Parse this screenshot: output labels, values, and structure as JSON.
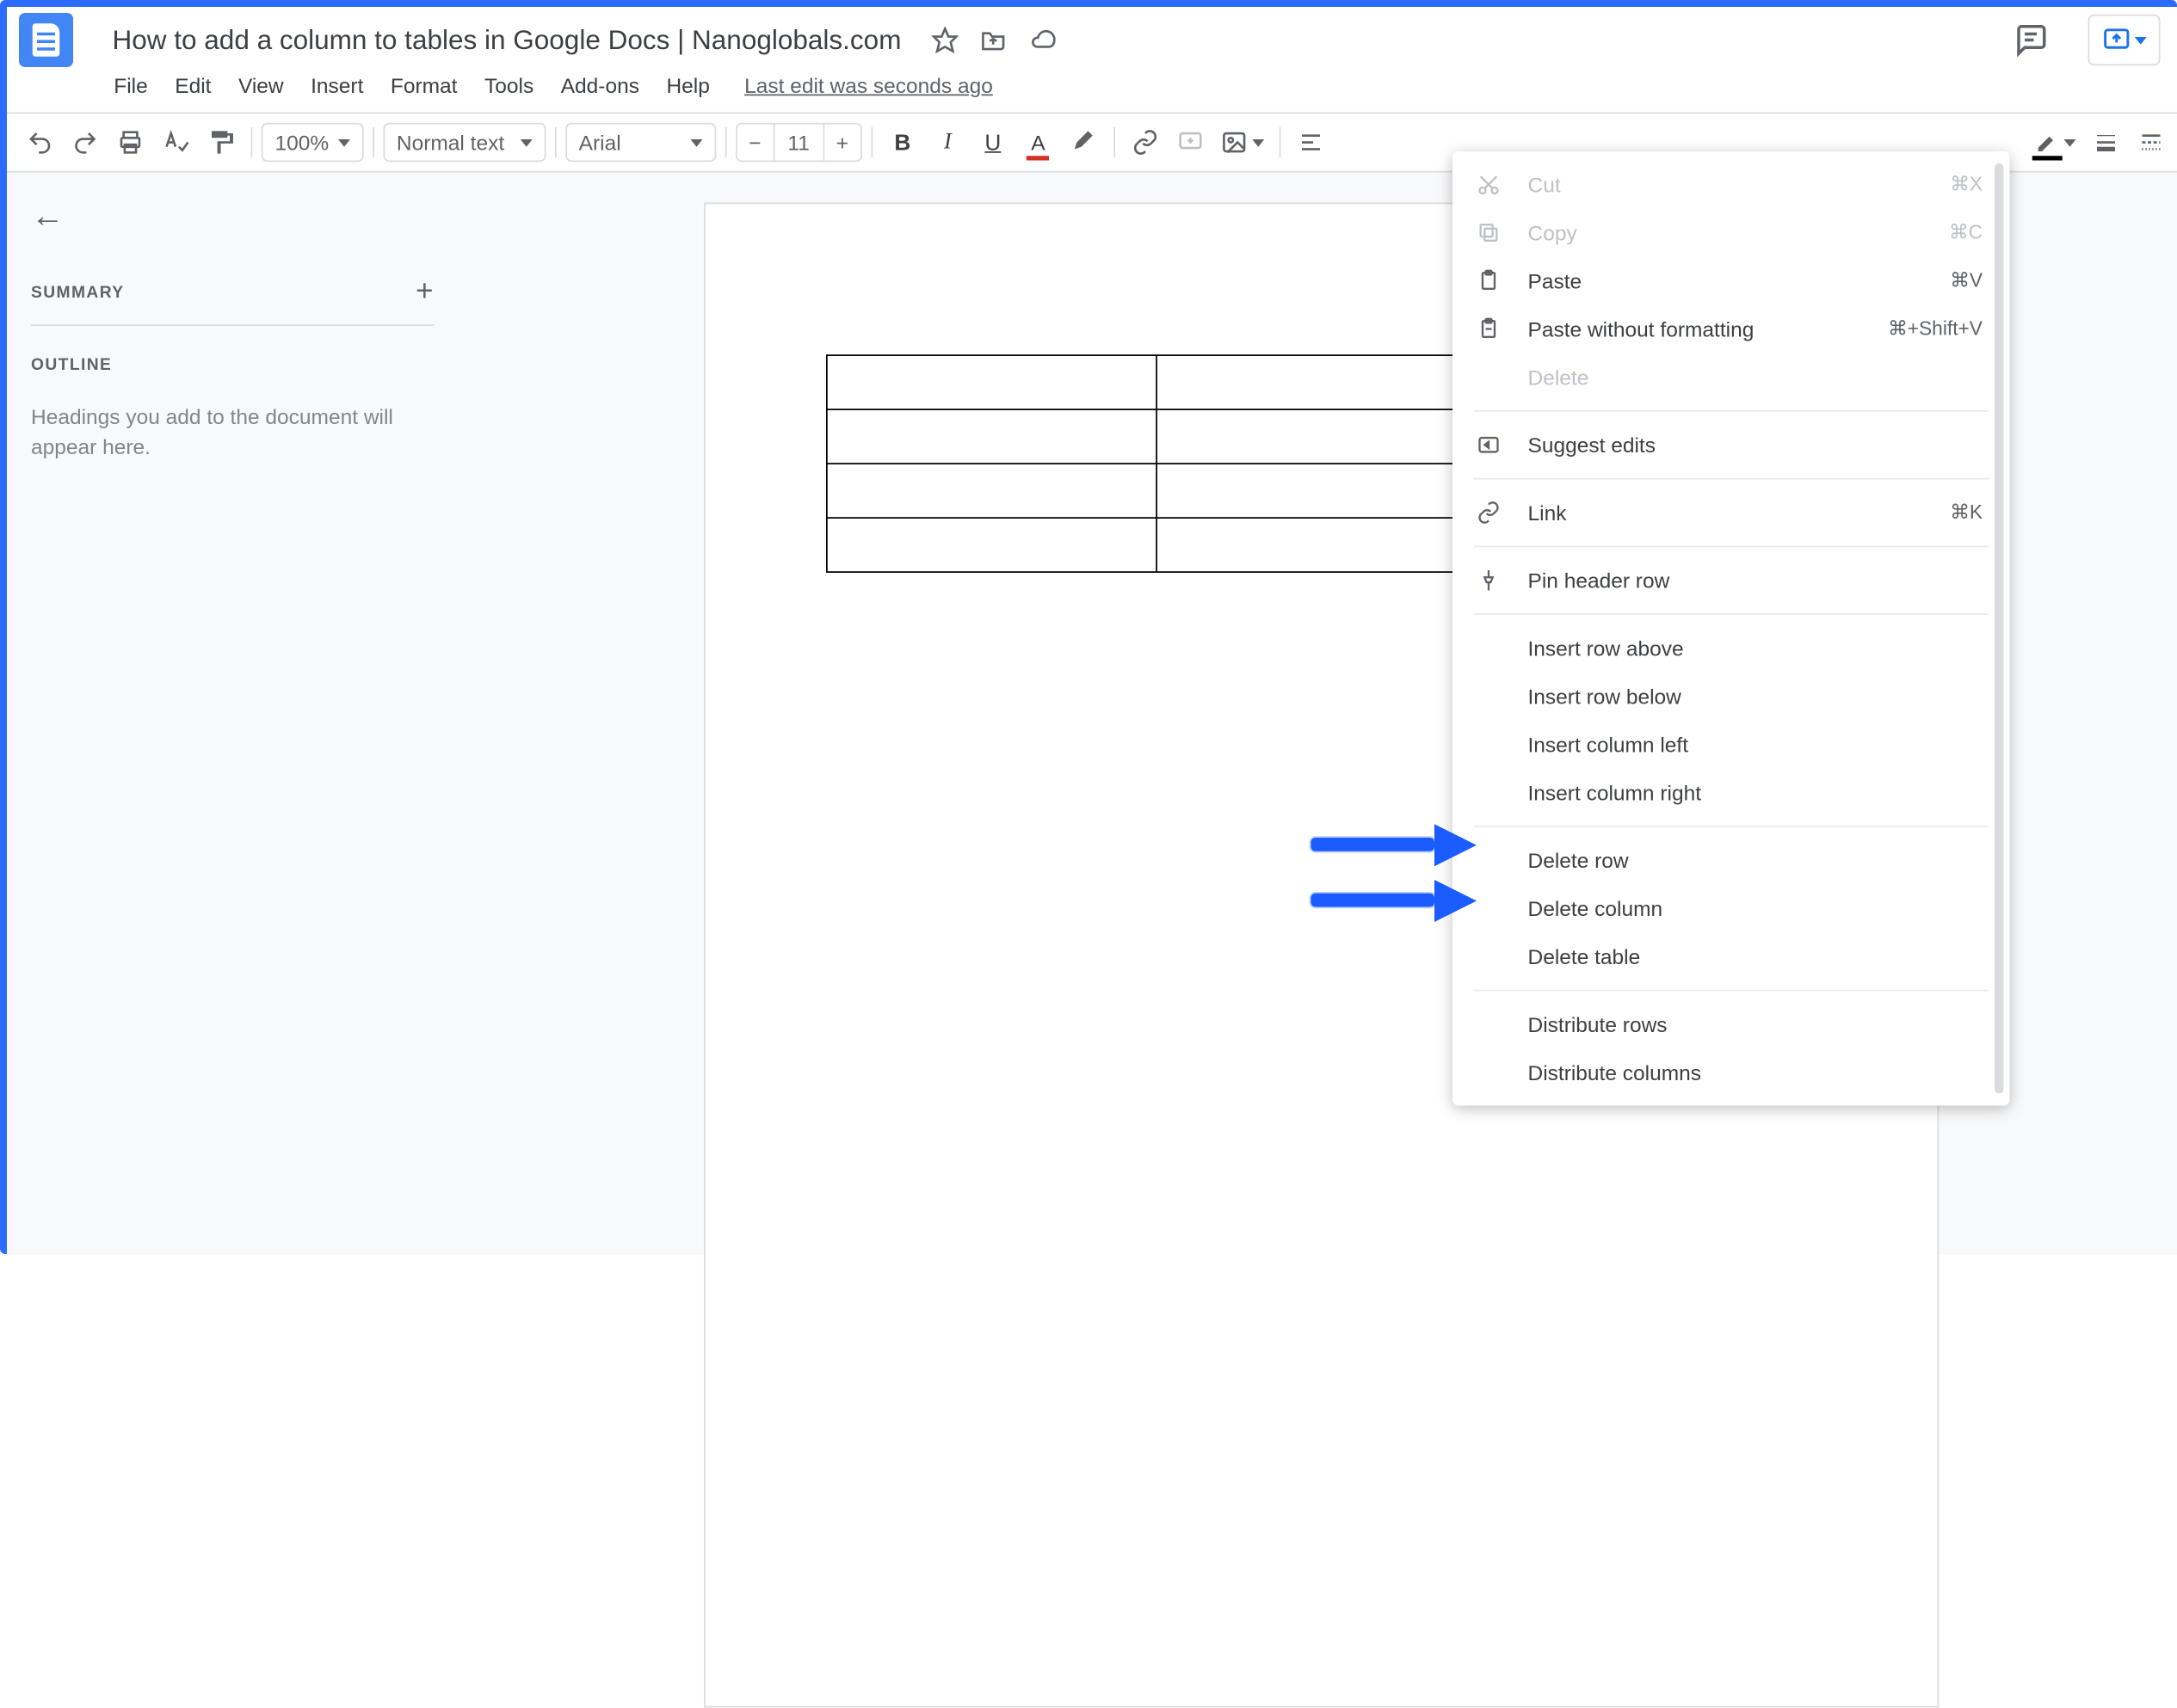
{
  "document": {
    "title": "How to add a column to tables in Google Docs | Nanoglobals.com",
    "last_edit": "Last edit was seconds ago"
  },
  "menubar": [
    "File",
    "Edit",
    "View",
    "Insert",
    "Format",
    "Tools",
    "Add-ons",
    "Help"
  ],
  "toolbar": {
    "zoom": "100%",
    "style": "Normal text",
    "font": "Arial",
    "size": "11"
  },
  "sidebar": {
    "summary_label": "SUMMARY",
    "outline_label": "OUTLINE",
    "outline_empty": "Headings you add to the document will appear here."
  },
  "table": {
    "rows": 4,
    "cols": 3
  },
  "context_menu": {
    "cut": {
      "label": "Cut",
      "shortcut": "⌘X"
    },
    "copy": {
      "label": "Copy",
      "shortcut": "⌘C"
    },
    "paste": {
      "label": "Paste",
      "shortcut": "⌘V"
    },
    "paste_wof": {
      "label": "Paste without formatting",
      "shortcut": "⌘+Shift+V"
    },
    "delete": {
      "label": "Delete"
    },
    "suggest": {
      "label": "Suggest edits"
    },
    "link": {
      "label": "Link",
      "shortcut": "⌘K"
    },
    "pin_header": {
      "label": "Pin header row"
    },
    "insert_row_above": {
      "label": "Insert row above"
    },
    "insert_row_below": {
      "label": "Insert row below"
    },
    "insert_col_left": {
      "label": "Insert column left"
    },
    "insert_col_right": {
      "label": "Insert column right"
    },
    "delete_row": {
      "label": "Delete row"
    },
    "delete_col": {
      "label": "Delete column"
    },
    "delete_table": {
      "label": "Delete table"
    },
    "dist_rows": {
      "label": "Distribute rows"
    },
    "dist_cols": {
      "label": "Distribute columns"
    }
  }
}
